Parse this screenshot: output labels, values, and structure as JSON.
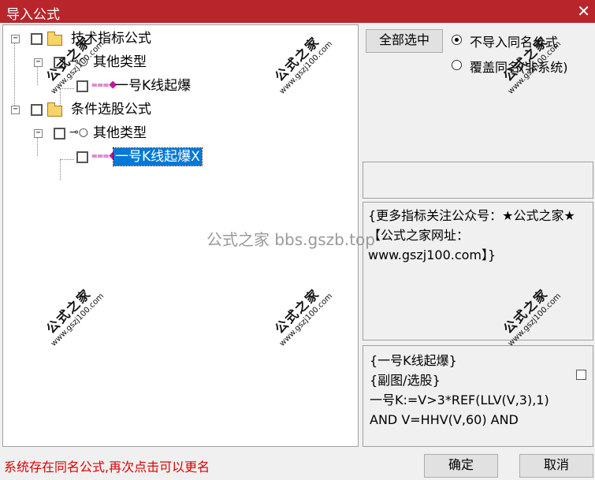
{
  "window": {
    "title": "导入公式",
    "close_glyph": "✕"
  },
  "tree": {
    "nodes": [
      {
        "label": "技术指标公式"
      },
      {
        "label": "其他类型"
      },
      {
        "label": "一号K线起爆"
      },
      {
        "label": "条件选股公式"
      },
      {
        "label": "其他类型"
      },
      {
        "label": "一号K线起爆X"
      }
    ],
    "expander_glyph": "−",
    "icons": {
      "folder": "folder-icon",
      "key": "key-icon",
      "formula": "gem-icon"
    }
  },
  "controls": {
    "select_all_label": "全部选中",
    "radio_no_import_label": "不导入同名公式",
    "radio_overwrite_label": "覆盖同名(非系统)",
    "selected_radio": "no_import"
  },
  "info_text": "{更多指标关注公众号：★公式之家★ 【公式之家网址：www.gszj100.com】}",
  "code_lines": [
    "{一号K线起爆}",
    "{副图/选股}",
    "一号K:=V>3*REF(LLV(V,3),1)",
    "AND V=HHV(V,60) AND"
  ],
  "status_text": "系统存在同名公式,再次点击可以更名",
  "buttons": {
    "ok": "确定",
    "cancel": "取消"
  },
  "watermark": {
    "title": "公式之家",
    "url": "www.gszj100.com",
    "center": "公式之家 bbs.gszb.top"
  },
  "colors": {
    "titlebar": "#b8262c",
    "selection": "#0078d7",
    "status": "#e00000"
  }
}
